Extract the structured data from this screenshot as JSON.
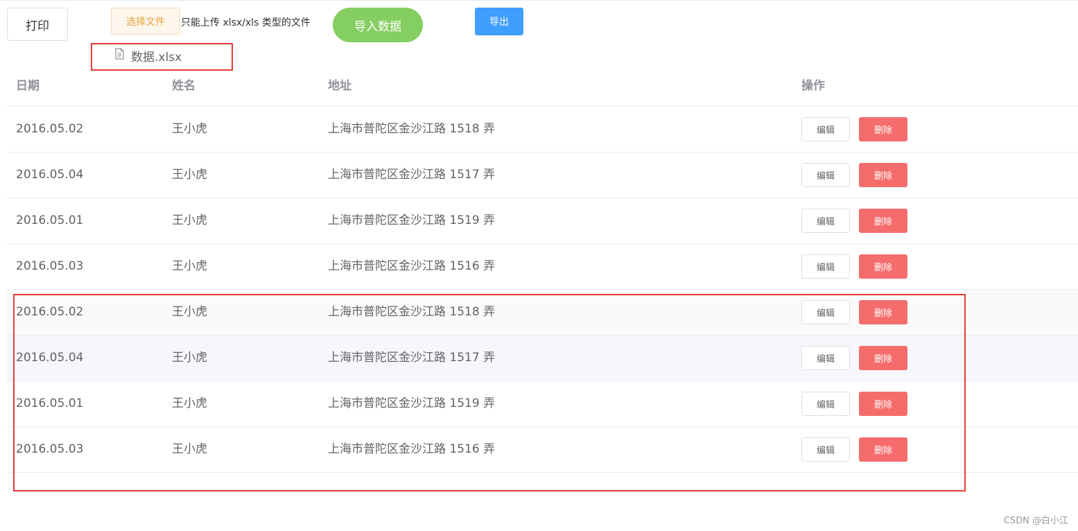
{
  "toolbar": {
    "print_label": "打印",
    "choose_file_label": "选择文件",
    "upload_tip": "只能上传 xlsx/xls 类型的文件",
    "import_label": "导入数据",
    "export_label": "导出"
  },
  "upload": {
    "file_name": "数据.xlsx",
    "file_icon": "document-icon"
  },
  "table": {
    "headers": [
      "日期",
      "姓名",
      "地址",
      "操作"
    ],
    "edit_label": "编辑",
    "delete_label": "删除",
    "rows": [
      {
        "date": "2016.05.02",
        "name": "王小虎",
        "address": "上海市普陀区金沙江路 1518 弄"
      },
      {
        "date": "2016.05.04",
        "name": "王小虎",
        "address": "上海市普陀区金沙江路 1517 弄"
      },
      {
        "date": "2016.05.01",
        "name": "王小虎",
        "address": "上海市普陀区金沙江路 1519 弄"
      },
      {
        "date": "2016.05.03",
        "name": "王小虎",
        "address": "上海市普陀区金沙江路 1516 弄"
      },
      {
        "date": "2016.05.02",
        "name": "王小虎",
        "address": "上海市普陀区金沙江路 1518 弄"
      },
      {
        "date": "2016.05.04",
        "name": "王小虎",
        "address": "上海市普陀区金沙江路 1517 弄"
      },
      {
        "date": "2016.05.01",
        "name": "王小虎",
        "address": "上海市普陀区金沙江路 1519 弄"
      },
      {
        "date": "2016.05.03",
        "name": "王小虎",
        "address": "上海市普陀区金沙江路 1516 弄"
      }
    ]
  },
  "watermark": "CSDN @白小江",
  "colors": {
    "success": "#85ce61",
    "primary": "#409eff",
    "danger": "#f56c6c",
    "warning": "#e6a23c",
    "annotation": "#e53935"
  }
}
